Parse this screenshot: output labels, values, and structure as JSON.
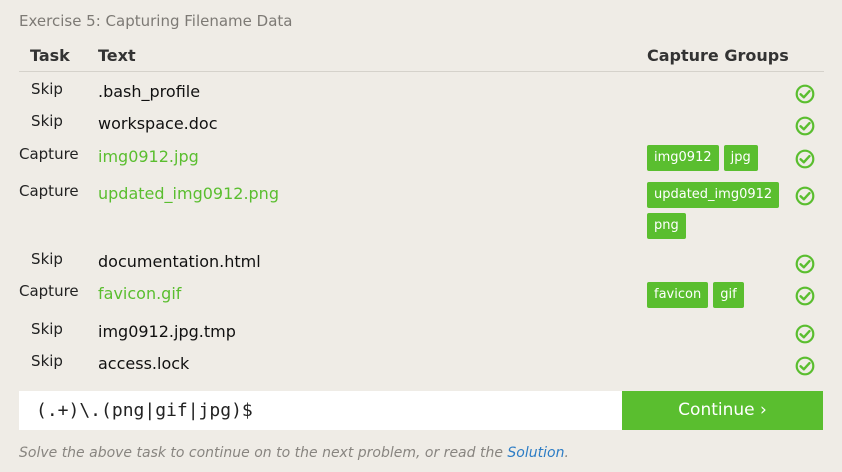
{
  "exercise_title": "Exercise 5: Capturing Filename Data",
  "table": {
    "headers": {
      "task": "Task",
      "text": "Text",
      "groups": "Capture Groups"
    },
    "rows": [
      {
        "task": "Skip",
        "text": ".bash_profile",
        "type": "skip",
        "groups": [],
        "status": "check-circle-icon"
      },
      {
        "task": "Skip",
        "text": "workspace.doc",
        "type": "skip",
        "groups": [],
        "status": "check-circle-icon"
      },
      {
        "task": "Capture",
        "text": "img0912.jpg",
        "type": "capture",
        "groups": [
          "img0912",
          "jpg"
        ],
        "status": "check-circle-icon"
      },
      {
        "task": "Capture",
        "text": "updated_img0912.png",
        "type": "capture",
        "groups": [
          "updated_img0912",
          "png"
        ],
        "status": "check-circle-icon"
      },
      {
        "task": "Skip",
        "text": "documentation.html",
        "type": "skip",
        "groups": [],
        "status": "check-circle-icon"
      },
      {
        "task": "Capture",
        "text": "favicon.gif",
        "type": "capture",
        "groups": [
          "favicon",
          "gif"
        ],
        "status": "check-circle-icon"
      },
      {
        "task": "Skip",
        "text": "img0912.jpg.tmp",
        "type": "skip",
        "groups": [],
        "status": "check-circle-icon"
      },
      {
        "task": "Skip",
        "text": "access.lock",
        "type": "skip",
        "groups": [],
        "status": "check-circle-icon"
      }
    ]
  },
  "regex_input": {
    "value": "(.+)\\.(png|gif|jpg)$"
  },
  "continue_button": {
    "label": "Continue ›"
  },
  "footer": {
    "text": "Solve the above task to continue on to the next problem, or read the ",
    "link": "Solution",
    "end": "."
  },
  "colors": {
    "accent": "#5abe2f",
    "link": "#2c7cc5",
    "background": "#efece6"
  }
}
